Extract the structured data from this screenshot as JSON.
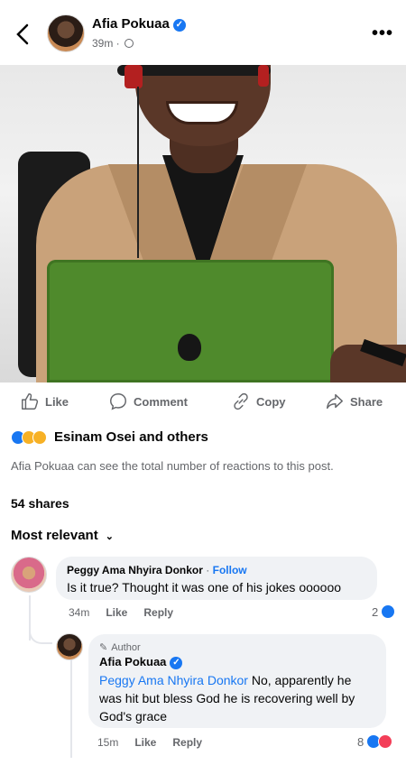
{
  "post": {
    "author": "Afia Pokuaa",
    "time": "39m ·",
    "more": "•••"
  },
  "actions": {
    "like": "Like",
    "comment": "Comment",
    "copy": "Copy",
    "share": "Share"
  },
  "reactions": {
    "summary": "Esinam Osei and others",
    "note": "Afia Pokuaa can see the total number of reactions to this post."
  },
  "shares": "54 shares",
  "sort": "Most relevant",
  "comments": [
    {
      "author": "Peggy Ama Nhyira Donkor",
      "separator": " · ",
      "follow": "Follow",
      "text": "Is it true? Thought it was one of his jokes oooooo",
      "time": "34m",
      "like": "Like",
      "reply": "Reply",
      "reaction_count": "2"
    }
  ],
  "reply": {
    "tag": "Author",
    "author": "Afia Pokuaa",
    "mention": "Peggy Ama Nhyira Donkor",
    "text": " No, apparently he was hit but bless God he is recovering well by God's grace",
    "time": "15m",
    "like": "Like",
    "reply": "Reply",
    "reaction_count": "8"
  },
  "icons": {
    "back": "chevron-left-icon",
    "verified": "verified-badge-icon",
    "audience": "globe-icon",
    "like": "thumbs-up-icon",
    "comment": "comment-bubble-icon",
    "copy": "link-icon",
    "share": "share-arrow-icon"
  },
  "colors": {
    "brand": "#1877f2",
    "muted": "#65676b",
    "bubble": "#f0f2f5"
  }
}
